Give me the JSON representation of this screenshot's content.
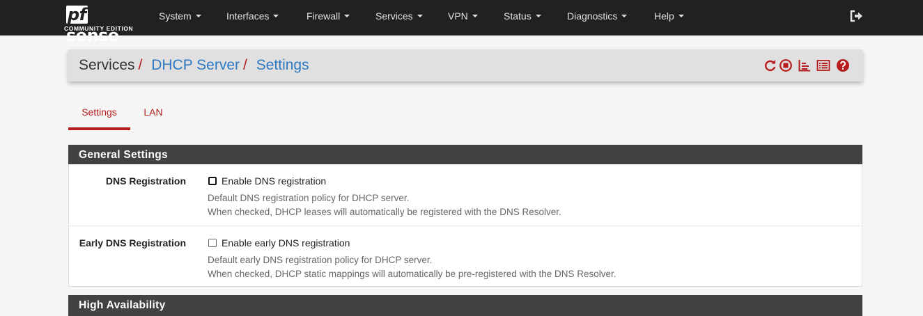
{
  "brand": {
    "logo_pf": "pf",
    "logo_main": "sense",
    "logo_sub": "COMMUNITY EDITION"
  },
  "nav": {
    "items": [
      {
        "label": "System"
      },
      {
        "label": "Interfaces"
      },
      {
        "label": "Firewall"
      },
      {
        "label": "Services"
      },
      {
        "label": "VPN"
      },
      {
        "label": "Status"
      },
      {
        "label": "Diagnostics"
      },
      {
        "label": "Help"
      }
    ],
    "logout_icon": "sign-out-icon"
  },
  "breadcrumb": {
    "root": "Services",
    "separator": "/",
    "level2": "DHCP Server",
    "level3": "Settings",
    "tools": [
      "restart-icon",
      "stop-icon",
      "log-icon",
      "list-icon",
      "help-icon"
    ]
  },
  "tabs": [
    {
      "label": "Settings",
      "active": true
    },
    {
      "label": "LAN",
      "active": false
    }
  ],
  "sections": {
    "general": {
      "title": "General Settings",
      "rows": [
        {
          "label": "DNS Registration",
          "checkbox_label": "Enable DNS registration",
          "checked": false,
          "help1": "Default DNS registration policy for DHCP server.",
          "help2": "When checked, DHCP leases will automatically be registered with the DNS Resolver."
        },
        {
          "label": "Early DNS Registration",
          "checkbox_label": "Enable early DNS registration",
          "checked": false,
          "help1": "Default early DNS registration policy for DHCP server.",
          "help2": "When checked, DHCP static mappings will automatically be pre-registered with the DNS Resolver."
        }
      ]
    },
    "ha": {
      "title": "High Availability"
    }
  },
  "colors": {
    "navbar": "#212121",
    "accent": "#b71c1c",
    "link": "#2e78c4",
    "panel_head": "#424242"
  }
}
